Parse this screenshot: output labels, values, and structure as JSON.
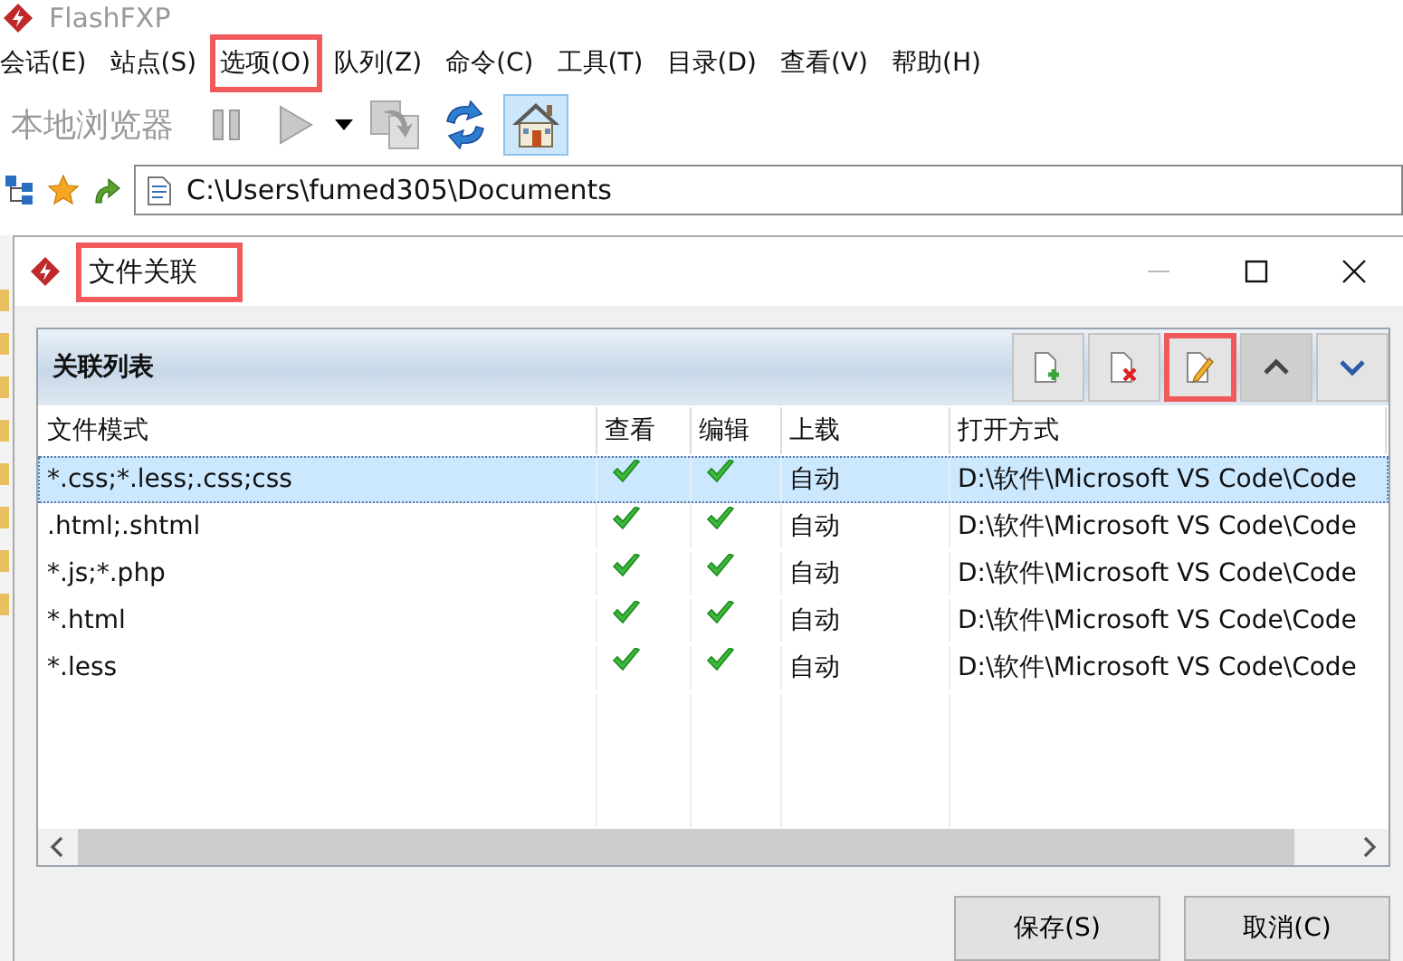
{
  "app": {
    "title": "FlashFXP",
    "menu": [
      {
        "label": "会话(E)",
        "highlighted": false
      },
      {
        "label": "站点(S)",
        "highlighted": false
      },
      {
        "label": "选项(O)",
        "highlighted": true
      },
      {
        "label": "队列(Z)",
        "highlighted": false
      },
      {
        "label": "命令(C)",
        "highlighted": false
      },
      {
        "label": "工具(T)",
        "highlighted": false
      },
      {
        "label": "目录(D)",
        "highlighted": false
      },
      {
        "label": "查看(V)",
        "highlighted": false
      },
      {
        "label": "帮助(H)",
        "highlighted": false
      }
    ],
    "toolbar": {
      "label": "本地浏览器",
      "buttons": [
        {
          "kind": "pause",
          "pressed": false
        },
        {
          "kind": "play",
          "pressed": false
        },
        {
          "kind": "dropdown",
          "pressed": false
        },
        {
          "kind": "transfer",
          "pressed": false
        },
        {
          "kind": "refresh",
          "pressed": false
        },
        {
          "kind": "home",
          "pressed": true
        }
      ]
    },
    "path": "C:\\Users\\fumed305\\Documents"
  },
  "dialog": {
    "title": "文件关联",
    "title_highlighted": true,
    "panel_title": "关联列表",
    "tools": [
      {
        "kind": "add",
        "highlighted": false
      },
      {
        "kind": "delete",
        "highlighted": false
      },
      {
        "kind": "edit",
        "highlighted": true
      },
      {
        "kind": "up",
        "highlighted": false
      },
      {
        "kind": "down",
        "highlighted": false
      }
    ],
    "columns": [
      "文件模式",
      "查看",
      "编辑",
      "上载",
      "打开方式"
    ],
    "rows": [
      {
        "pattern": "*.css;*.less;.css;css",
        "view": true,
        "edit": true,
        "upload": "自动",
        "open_with": "D:\\软件\\Microsoft VS Code\\Code",
        "selected": true
      },
      {
        "pattern": ".html;.shtml",
        "view": true,
        "edit": true,
        "upload": "自动",
        "open_with": "D:\\软件\\Microsoft VS Code\\Code",
        "selected": false
      },
      {
        "pattern": "*.js;*.php",
        "view": true,
        "edit": true,
        "upload": "自动",
        "open_with": "D:\\软件\\Microsoft VS Code\\Code",
        "selected": false
      },
      {
        "pattern": "*.html",
        "view": true,
        "edit": true,
        "upload": "自动",
        "open_with": "D:\\软件\\Microsoft VS Code\\Code",
        "selected": false
      },
      {
        "pattern": "*.less",
        "view": true,
        "edit": true,
        "upload": "自动",
        "open_with": "D:\\软件\\Microsoft VS Code\\Code",
        "selected": false
      }
    ],
    "buttons": [
      "保存(S)",
      "取消(C)"
    ]
  }
}
